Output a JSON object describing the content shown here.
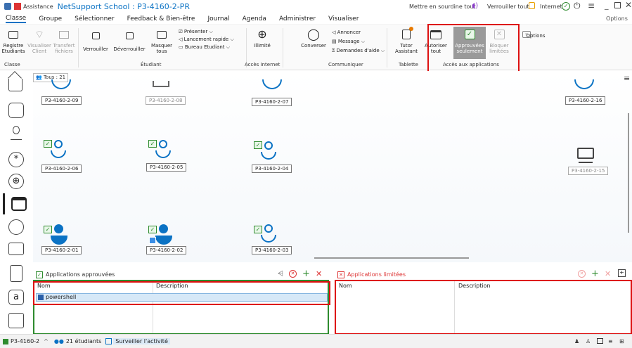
{
  "titlebar": {
    "assist_label": "Assistance",
    "title": "NetSupport School : P3-4160-2-PR",
    "mute_label": "Mettre en sourdine tout",
    "lock_all_label": "Verrouiller tout",
    "internet_label": "Internet",
    "options_label": "Options"
  },
  "menu": [
    "Classe",
    "Groupe",
    "Sélectionner",
    "Feedback & Bien-être",
    "Journal",
    "Agenda",
    "Administrer",
    "Visualiser"
  ],
  "ribbon": {
    "registre": "Registre Etudiants",
    "visualiser": "Visualiser Client",
    "transfert": "Transfert fichiers",
    "verrouiller": "Verrouiller",
    "deverrouiller": "Déverrouiller",
    "masquer": "Masquer tous",
    "presenter": "Présenter",
    "lancement": "Lancement rapide",
    "bureau": "Bureau Etudiant",
    "illimite": "Illimité",
    "converser": "Converser",
    "annoncer": "Annoncer",
    "message": "Message",
    "demandes": "Demandes d'aide",
    "tutor": "Tutor Assistant",
    "autoriser": "Autoriser tout",
    "approuvees": "Approuvées seulement",
    "bloquer": "Bloquer limitées",
    "options": "Options",
    "groups": {
      "classe": "Classe",
      "etudiant": "Étudiant",
      "acces_internet": "Accès Internet",
      "communiquer": "Communiquer",
      "tablette": "Tablette",
      "acces_apps": "Accès aux applications"
    }
  },
  "tab_all": "Tous : 21",
  "students": {
    "s09": "P3-4160-2-09",
    "s08": "P3-4160-2-08",
    "s07": "P3-4160-2-07",
    "s16": "P3-4160-2-16",
    "s06": "P3-4160-2-06",
    "s05": "P3-4160-2-05",
    "s04": "P3-4160-2-04",
    "s15": "P3-4160-2-15",
    "s01": "P3-4160-2-01",
    "s02": "P3-4160-2-02",
    "s03": "P3-4160-2-03"
  },
  "approved": {
    "title": "Applications approuvées",
    "col_name": "Nom",
    "col_desc": "Description",
    "rows": [
      {
        "name": "powershell",
        "desc": ""
      }
    ]
  },
  "limited": {
    "title": "Applications limitées",
    "col_name": "Nom",
    "col_desc": "Description"
  },
  "status": {
    "machine": "P3-4160-2",
    "students": "21 étudiants",
    "monitor": "Surveiller l'activité"
  },
  "colors": {
    "accent": "#0a72c4",
    "green": "#2e8b2e",
    "red": "#d11111"
  }
}
